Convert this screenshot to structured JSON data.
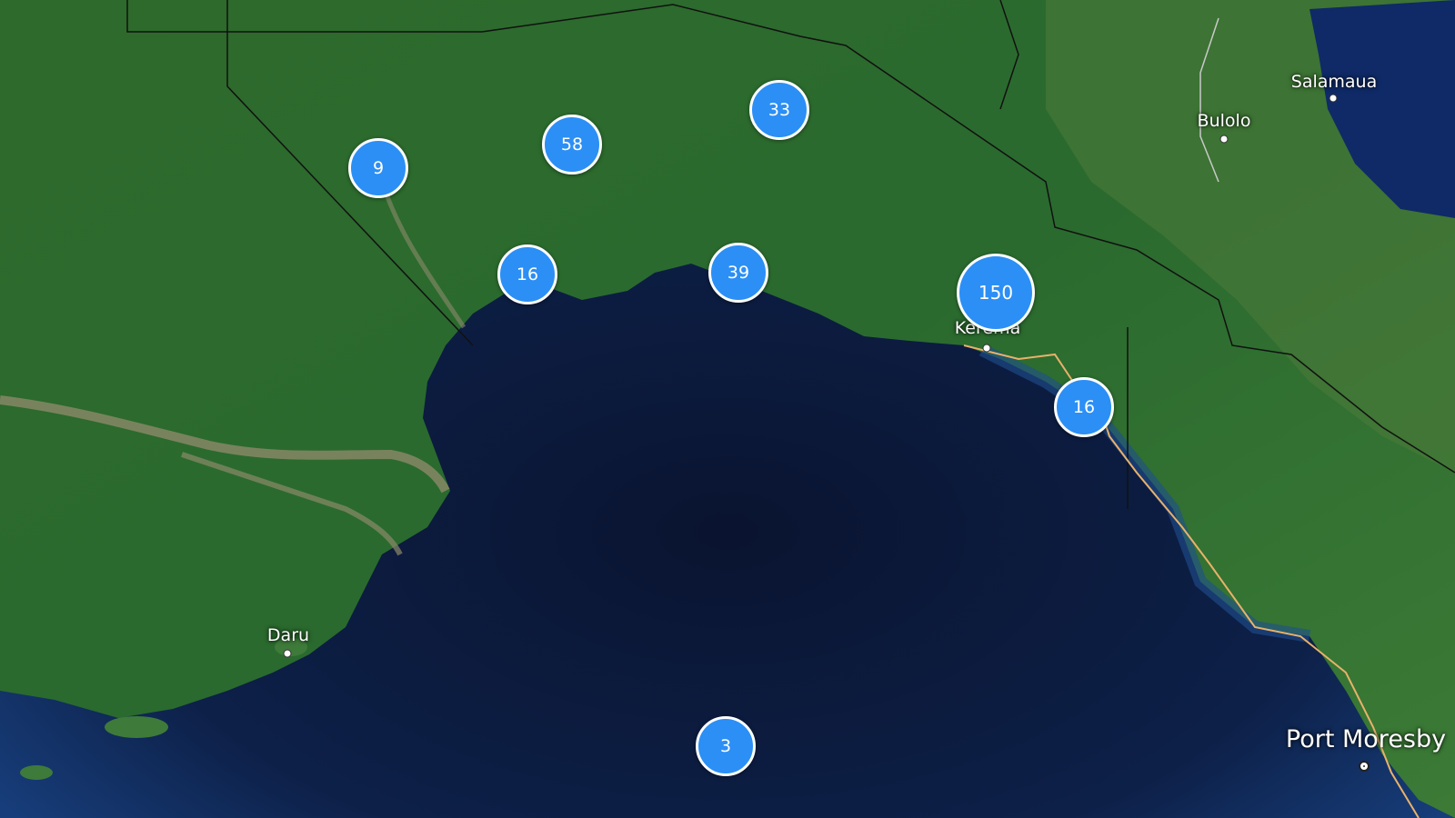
{
  "map": {
    "colors": {
      "ocean": "#0b1a3a",
      "land": "#2f6b2a",
      "cluster": "#2b8ff5",
      "cluster_border": "#ffffff",
      "road": "#e8b26a",
      "border": "#111111"
    },
    "clusters": [
      {
        "count": "9"
      },
      {
        "count": "58"
      },
      {
        "count": "33"
      },
      {
        "count": "16"
      },
      {
        "count": "39"
      },
      {
        "count": "150"
      },
      {
        "count": "16"
      },
      {
        "count": "3"
      }
    ],
    "places": {
      "salamaua": "Salamaua",
      "bulolo": "Bulolo",
      "kerema": "Kerema",
      "daru": "Daru",
      "port_moresby": "Port Moresby"
    }
  }
}
